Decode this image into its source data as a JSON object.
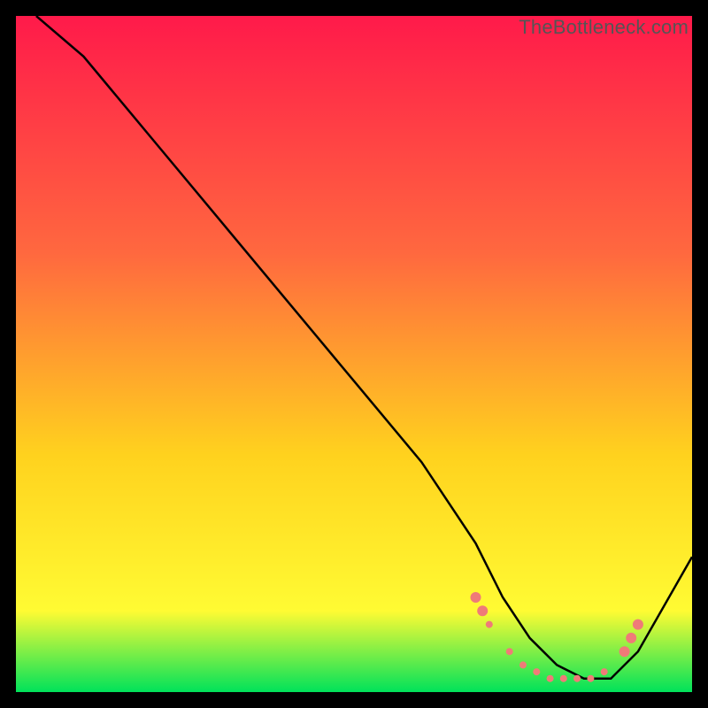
{
  "watermark": "TheBottleneck.com",
  "chart_data": {
    "type": "line",
    "title": "",
    "xlabel": "",
    "ylabel": "",
    "xlim": [
      0,
      100
    ],
    "ylim": [
      0,
      100
    ],
    "background_gradient": {
      "top": "#ff1a4a",
      "mid1": "#ff683f",
      "mid2": "#ffd21e",
      "mid3": "#fffb33",
      "bottom": "#00e25a"
    },
    "series": [
      {
        "name": "bottleneck-curve",
        "color": "#000000",
        "x": [
          3,
          10,
          20,
          30,
          40,
          50,
          60,
          68,
          72,
          76,
          80,
          84,
          88,
          92,
          100
        ],
        "y": [
          100,
          94,
          82,
          70,
          58,
          46,
          34,
          22,
          14,
          8,
          4,
          2,
          2,
          6,
          20
        ]
      }
    ],
    "markers": {
      "name": "highlighted-range",
      "color": "#ef7b78",
      "radius_small": 4,
      "radius_large": 6,
      "points": [
        {
          "x": 68,
          "y": 14,
          "r": 6
        },
        {
          "x": 69,
          "y": 12,
          "r": 6
        },
        {
          "x": 70,
          "y": 10,
          "r": 4
        },
        {
          "x": 73,
          "y": 6,
          "r": 4
        },
        {
          "x": 75,
          "y": 4,
          "r": 4
        },
        {
          "x": 77,
          "y": 3,
          "r": 4
        },
        {
          "x": 79,
          "y": 2,
          "r": 4
        },
        {
          "x": 81,
          "y": 2,
          "r": 4
        },
        {
          "x": 83,
          "y": 2,
          "r": 4
        },
        {
          "x": 85,
          "y": 2,
          "r": 4
        },
        {
          "x": 87,
          "y": 3,
          "r": 4
        },
        {
          "x": 90,
          "y": 6,
          "r": 6
        },
        {
          "x": 91,
          "y": 8,
          "r": 6
        },
        {
          "x": 92,
          "y": 10,
          "r": 6
        }
      ]
    }
  }
}
